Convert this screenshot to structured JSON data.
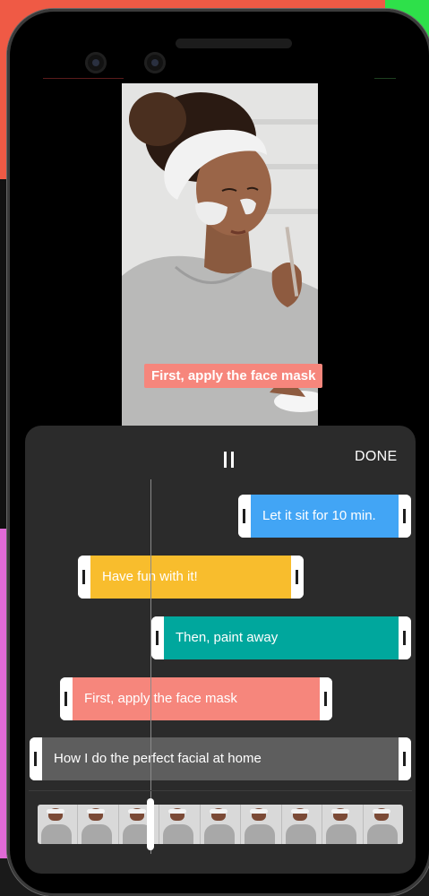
{
  "video": {
    "caption": "First, apply the face mask"
  },
  "controls": {
    "pause_icon": "pause-icon",
    "done_label": "DONE"
  },
  "tracks": [
    {
      "text": "Let it sit for 10 min.",
      "color": "#42a5f5"
    },
    {
      "text": "Have fun with it!",
      "color": "#f8bd2d"
    },
    {
      "text": "Then, paint away",
      "color": "#00a79d"
    },
    {
      "text": "First, apply the face mask",
      "color": "#f6867c"
    },
    {
      "text": "How I do the perfect facial at home",
      "color": "#5e5e5e"
    }
  ],
  "filmstrip": {
    "frame_count": 9
  }
}
